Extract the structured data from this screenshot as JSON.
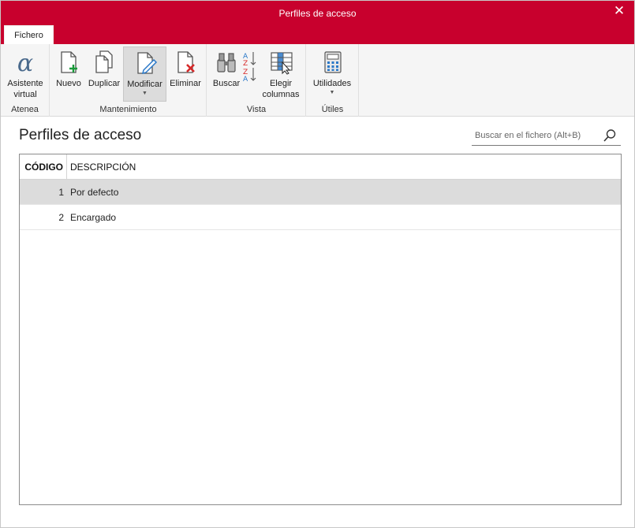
{
  "window": {
    "title": "Perfiles de acceso",
    "close_glyph": "✕"
  },
  "tabs": [
    {
      "label": "Fichero"
    }
  ],
  "ribbon": {
    "groups": [
      {
        "label": "Atenea",
        "buttons": [
          {
            "label": "Asistente virtual",
            "icon": "alpha-icon"
          }
        ]
      },
      {
        "label": "Mantenimiento",
        "buttons": [
          {
            "label": "Nuevo",
            "icon": "new-document-icon"
          },
          {
            "label": "Duplicar",
            "icon": "duplicate-icon"
          },
          {
            "label": "Modificar",
            "icon": "edit-document-icon",
            "dropdown": true
          },
          {
            "label": "Eliminar",
            "icon": "delete-document-icon"
          }
        ]
      },
      {
        "label": "Vista",
        "buttons": [
          {
            "label": "Buscar",
            "icon": "binoculars-icon"
          },
          {
            "label": "",
            "icon": "sort-icon"
          },
          {
            "label": "Elegir columnas",
            "icon": "columns-icon"
          }
        ]
      },
      {
        "label": "Útiles",
        "buttons": [
          {
            "label": "Utilidades",
            "icon": "calculator-icon",
            "dropdown": true
          }
        ]
      }
    ]
  },
  "page": {
    "title": "Perfiles de acceso"
  },
  "search": {
    "placeholder": "Buscar en el fichero (Alt+B)",
    "value": ""
  },
  "table": {
    "columns": [
      "CÓDIGO",
      "DESCRIPCIÓN"
    ],
    "rows": [
      {
        "codigo": "1",
        "descripcion": "Por defecto",
        "selected": true
      },
      {
        "codigo": "2",
        "descripcion": "Encargado",
        "selected": false
      }
    ]
  },
  "colors": {
    "accent": "#c8002d",
    "ribbon_bg": "#f5f5f5",
    "selected_row": "#dcdcdc",
    "green": "#1a9a3a",
    "red": "#d62828",
    "blue": "#2a78c8"
  }
}
